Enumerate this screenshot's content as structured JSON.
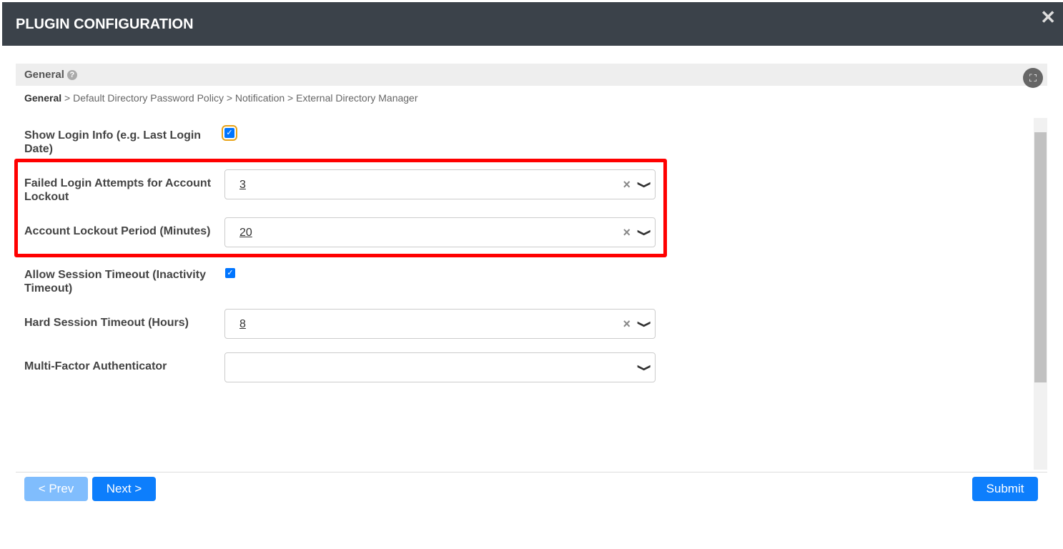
{
  "header": {
    "title": "PLUGIN CONFIGURATION"
  },
  "section": {
    "title": "General"
  },
  "breadcrumb": {
    "current": "General",
    "rest": " > Default Directory Password Policy > Notification > External Directory Manager"
  },
  "fields": [
    {
      "label": "Show Login Info (e.g. Last Login Date)",
      "checked": true
    },
    {
      "label": "Failed Login Attempts for Account Lockout",
      "value": "3"
    },
    {
      "label": "Account Lockout Period (Minutes)",
      "value": "20"
    },
    {
      "label": "Allow Session Timeout (Inactivity Timeout)",
      "checked": true
    },
    {
      "label": "Hard Session Timeout (Hours)",
      "value": "8"
    },
    {
      "label": "Multi-Factor Authenticator",
      "value": ""
    }
  ],
  "buttons": {
    "prev": "< Prev",
    "next": "Next >",
    "submit": "Submit"
  }
}
